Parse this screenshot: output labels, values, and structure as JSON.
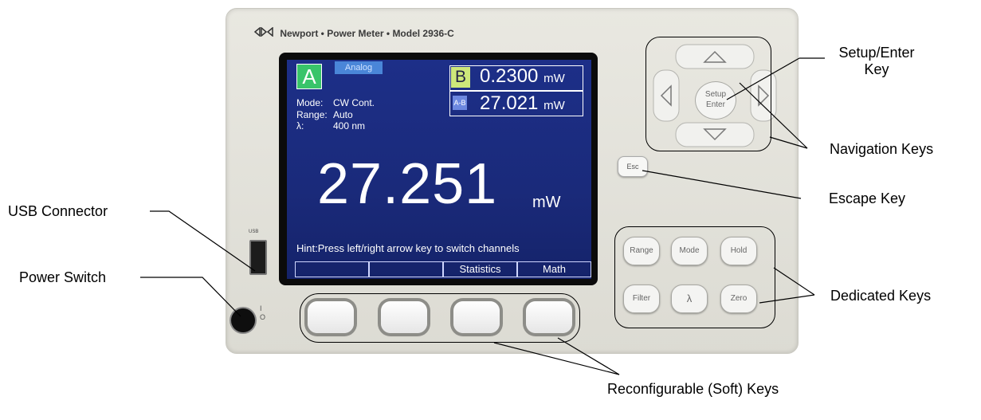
{
  "device": {
    "brand": "Newport • Power Meter • Model 2936-C",
    "logo_icon": "newport-logo-icon"
  },
  "screen": {
    "channel_a": "A",
    "analog_tag": "Analog",
    "channel_b": {
      "label": "B",
      "value": "0.2300",
      "unit": "mW"
    },
    "channel_ab": {
      "label": "A-B",
      "value": "27.021",
      "unit": "mW"
    },
    "info": [
      {
        "label": "Mode:",
        "value": "CW Cont."
      },
      {
        "label": "Range:",
        "value": "Auto"
      },
      {
        "label": "λ:",
        "value": "400 nm"
      }
    ],
    "main_value": "27.251",
    "main_unit": "mW",
    "hint": "Hint:Press left/right arrow key to switch channels",
    "soft_labels": [
      "",
      "",
      "Statistics",
      "Math"
    ],
    "colors": {
      "screen_bg": "#1d2f88",
      "channel_a": "#39c46a",
      "channel_b": "#cde77a",
      "analog": "#4a86d8"
    }
  },
  "keys": {
    "setup_line1": "Setup",
    "setup_line2": "Enter",
    "esc": "Esc",
    "dedicated": [
      "Range",
      "Mode",
      "Hold",
      "Filter",
      "λ",
      "Zero"
    ]
  },
  "ports": {
    "usb_label": "USB",
    "power_on": "I",
    "power_off": "O"
  },
  "callouts": {
    "setup_enter": [
      "Setup/Enter",
      "Key"
    ],
    "navigation": "Navigation Keys",
    "escape": "Escape Key",
    "usb": "USB Connector",
    "power": "Power Switch",
    "dedicated": "Dedicated Keys",
    "soft": "Reconfigurable (Soft) Keys"
  }
}
